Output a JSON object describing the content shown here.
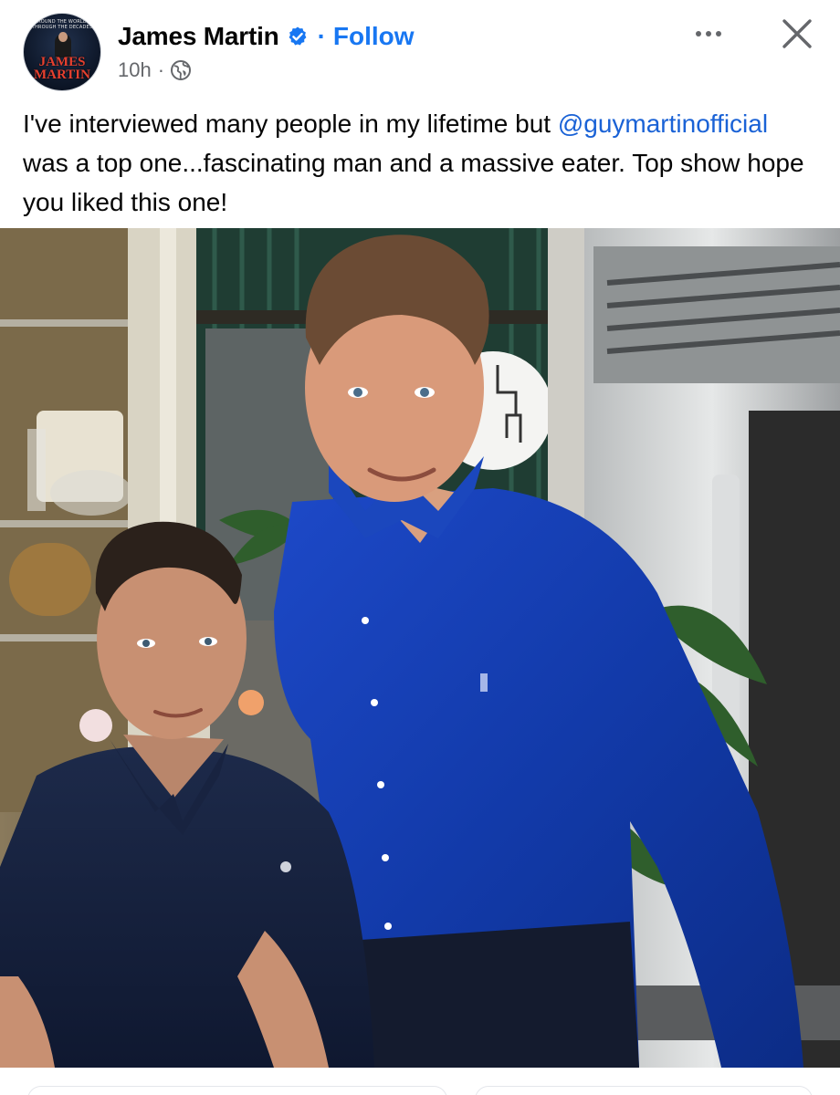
{
  "post": {
    "author": {
      "name": "James Martin",
      "verified": true,
      "avatar": {
        "top_text": "AROUND THE WORLD · THROUGH THE DECADES",
        "name_text": "JAMES MARTIN"
      }
    },
    "separator": "·",
    "follow_label": "Follow",
    "time": "10h",
    "time_separator": "·",
    "audience_icon": "globe-icon",
    "more_icon": "more-options-icon",
    "close_icon": "close-icon",
    "caption": {
      "line_start": "I've interviewed many people in my lifetime but ",
      "mention": "@guymartinofficial",
      "line_end": " was a top one...fascinating man and a massive eater. Top show hope you liked this one!"
    }
  },
  "colors": {
    "accent": "#1877f2",
    "mention": "#1a62d6",
    "text": "#050505",
    "muted": "#65676b"
  }
}
